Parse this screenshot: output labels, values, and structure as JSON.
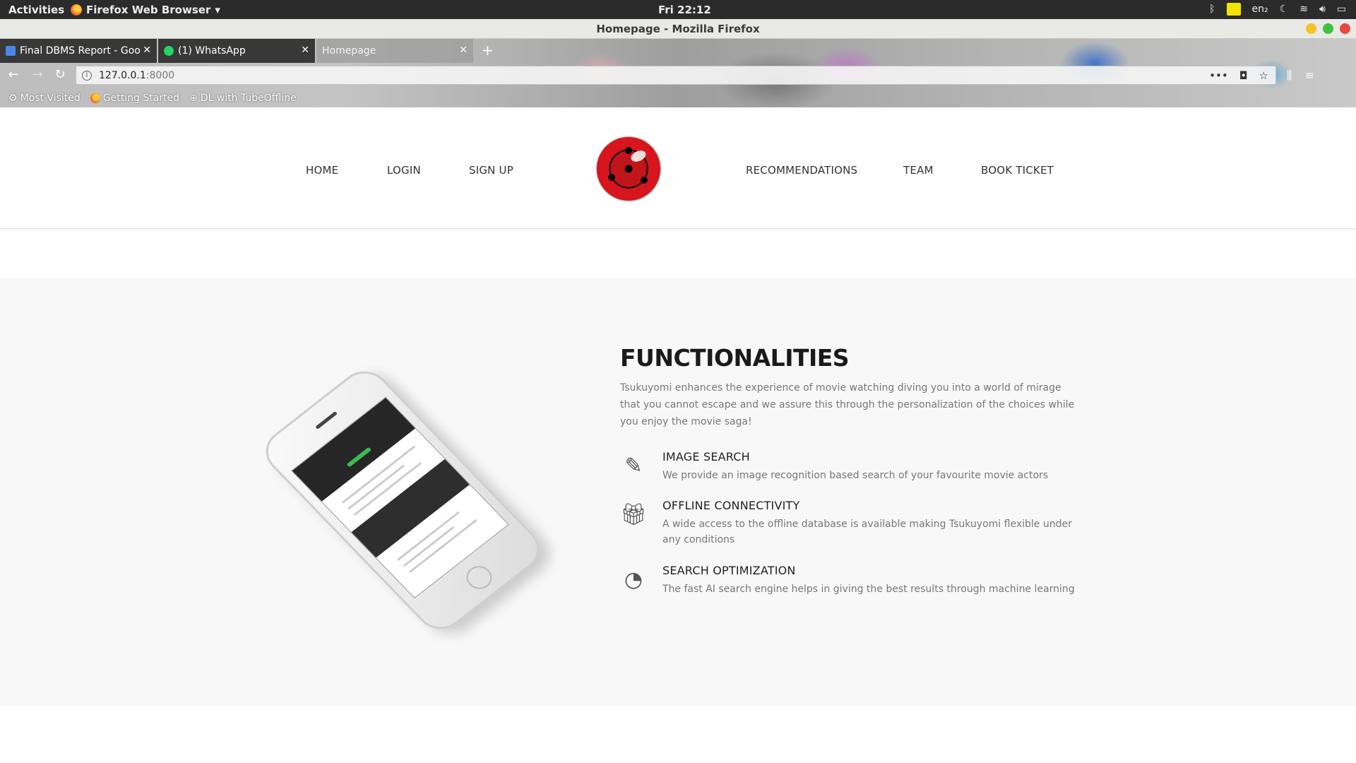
{
  "system": {
    "activities": "Activities",
    "app_menu": "Firefox Web Browser",
    "clock": "Fri 22:12",
    "lang": "en₂"
  },
  "window": {
    "title": "Homepage - Mozilla Firefox"
  },
  "tabs": [
    {
      "label": "Final DBMS Report - Goo",
      "favicon_color": "#4a86e8"
    },
    {
      "label": "(1) WhatsApp",
      "favicon_color": "#25d366"
    },
    {
      "label": "Homepage"
    }
  ],
  "urlbar": {
    "host": "127.0.0.1",
    "port": ":8000"
  },
  "bookmarks": [
    {
      "label": "Most Visited"
    },
    {
      "label": "Getting Started"
    },
    {
      "label": "DL with TubeOffline"
    }
  ],
  "site_nav": {
    "left": [
      "HOME",
      "LOGIN",
      "SIGN UP"
    ],
    "right": [
      "RECOMMENDATIONS",
      "TEAM",
      "BOOK TICKET"
    ]
  },
  "features": {
    "title": "FUNCTIONALITIES",
    "description": "Tsukuyomi enhances the experience of movie watching diving you into a world of mirage that you cannot escape and we assure this through the personalization of the choices while you enjoy the movie saga!",
    "items": [
      {
        "icon": "magic-wand-icon",
        "heading": "IMAGE SEARCH",
        "text": "We provide an image recognition based search of your favourite movie actors"
      },
      {
        "icon": "gift-icon",
        "heading": "OFFLINE CONNECTIVITY",
        "text": "A wide access to the offline database is available making Tsukuyomi flexible under any conditions"
      },
      {
        "icon": "dashboard-icon",
        "heading": "SEARCH OPTIMIZATION",
        "text": "The fast AI search engine helps in giving the best results through machine learning"
      }
    ]
  },
  "colors": {
    "accent_close": "#e8463e",
    "accent_max": "#3cc43c",
    "accent_min": "#f5c325",
    "logo_red": "#c2141b"
  }
}
